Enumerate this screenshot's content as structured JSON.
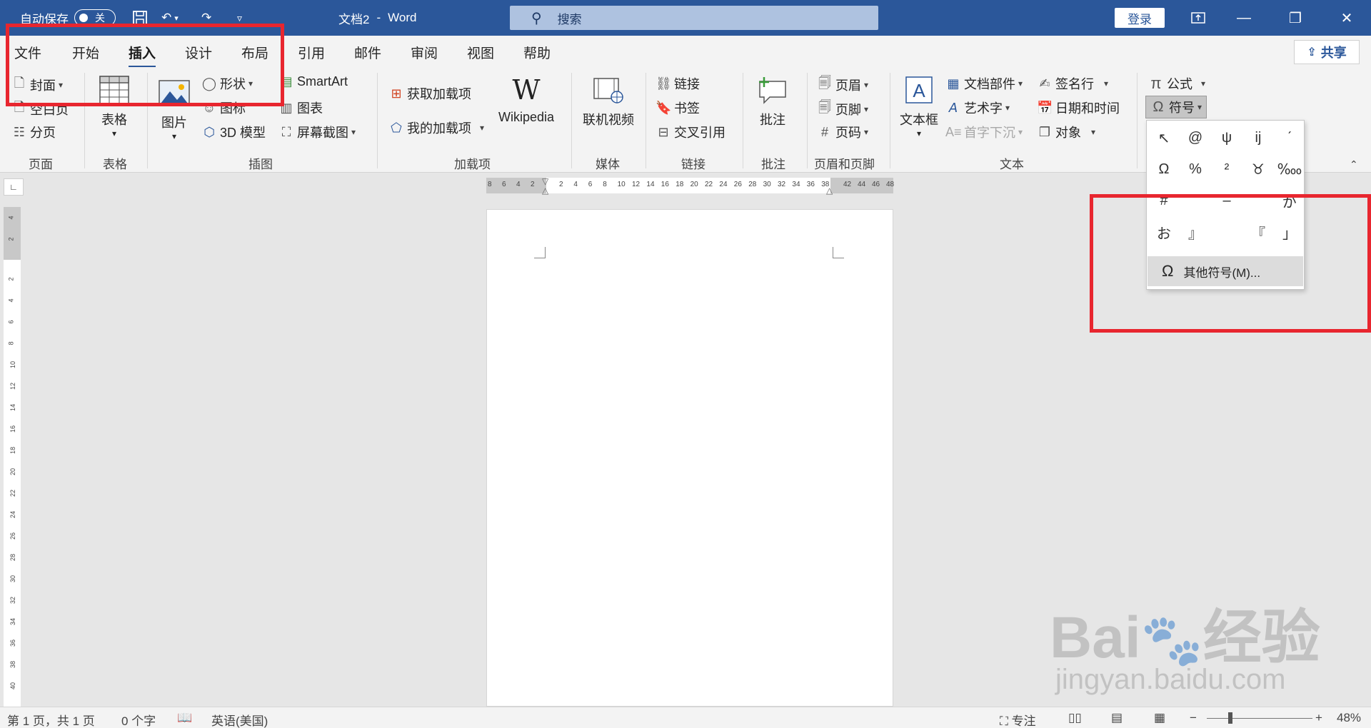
{
  "titlebar": {
    "autosave_label": "自动保存",
    "autosave_state": "关",
    "doc_title": "文档2",
    "title_sep": "-",
    "app_name": "Word",
    "search_placeholder": "搜索",
    "login_label": "登录"
  },
  "tabs": [
    "文件",
    "开始",
    "插入",
    "设计",
    "布局",
    "引用",
    "邮件",
    "审阅",
    "视图",
    "帮助"
  ],
  "active_tab": "插入",
  "share_label": "共享",
  "ribbon": {
    "pages": {
      "cover": "封面",
      "blank": "空白页",
      "break": "分页",
      "group": "页面"
    },
    "tables": {
      "table": "表格",
      "group": "表格"
    },
    "illustrations": {
      "picture": "图片",
      "shapes": "形状",
      "icons": "图标",
      "model3d": "3D 模型",
      "smartart": "SmartArt",
      "chart": "图表",
      "screenshot": "屏幕截图",
      "group": "插图"
    },
    "addins": {
      "get": "获取加载项",
      "mine": "我的加载项",
      "wikipedia": "Wikipedia",
      "group": "加载项"
    },
    "media": {
      "video": "联机视频",
      "group": "媒体"
    },
    "links": {
      "link": "链接",
      "bookmark": "书签",
      "crossref": "交叉引用",
      "group": "链接"
    },
    "comments": {
      "comment": "批注",
      "group": "批注"
    },
    "headerfooter": {
      "header": "页眉",
      "footer": "页脚",
      "pagenum": "页码",
      "group": "页眉和页脚"
    },
    "text": {
      "textbox": "文本框",
      "quickparts": "文档部件",
      "wordart": "艺术字",
      "dropcap": "首字下沉",
      "signature": "签名行",
      "datetime": "日期和时间",
      "object": "对象",
      "group": "文本"
    },
    "symbols": {
      "equation": "公式",
      "symbol": "符号"
    }
  },
  "symbol_dropdown": {
    "symbols": [
      "↖",
      "@",
      "ψ",
      "ĳ",
      "ˊ",
      "Ω",
      "%",
      "²",
      "♉",
      "‱",
      "#",
      "",
      "–",
      "",
      "が",
      "お",
      "』",
      "",
      "『",
      "」",
      "「"
    ],
    "more_label": "其他符号(M)..."
  },
  "ruler": {
    "h_left": [
      "8",
      "6",
      "4",
      "2"
    ],
    "h_main": [
      "2",
      "4",
      "6",
      "8",
      "10",
      "12",
      "14",
      "16",
      "18",
      "20",
      "22",
      "24",
      "26",
      "28",
      "30",
      "32",
      "34",
      "36",
      "38"
    ],
    "h_right": [
      "42",
      "44",
      "46",
      "48"
    ],
    "v_top": [
      "4",
      "2"
    ],
    "v_main": [
      "2",
      "4",
      "6",
      "8",
      "10",
      "12",
      "14",
      "16",
      "18",
      "20",
      "22",
      "24",
      "26",
      "28",
      "30",
      "32",
      "34",
      "36",
      "38",
      "40"
    ]
  },
  "statusbar": {
    "page_info": "第 1 页，共 1 页",
    "word_count": "0 个字",
    "language": "英语(美国)",
    "focus": "专注",
    "zoom": "48%"
  },
  "watermark": {
    "brand": "Bai",
    "brand2": "经验",
    "url": "jingyan.baidu.com"
  },
  "colors": {
    "accent": "#2b579a",
    "highlight": "#e8262f"
  }
}
